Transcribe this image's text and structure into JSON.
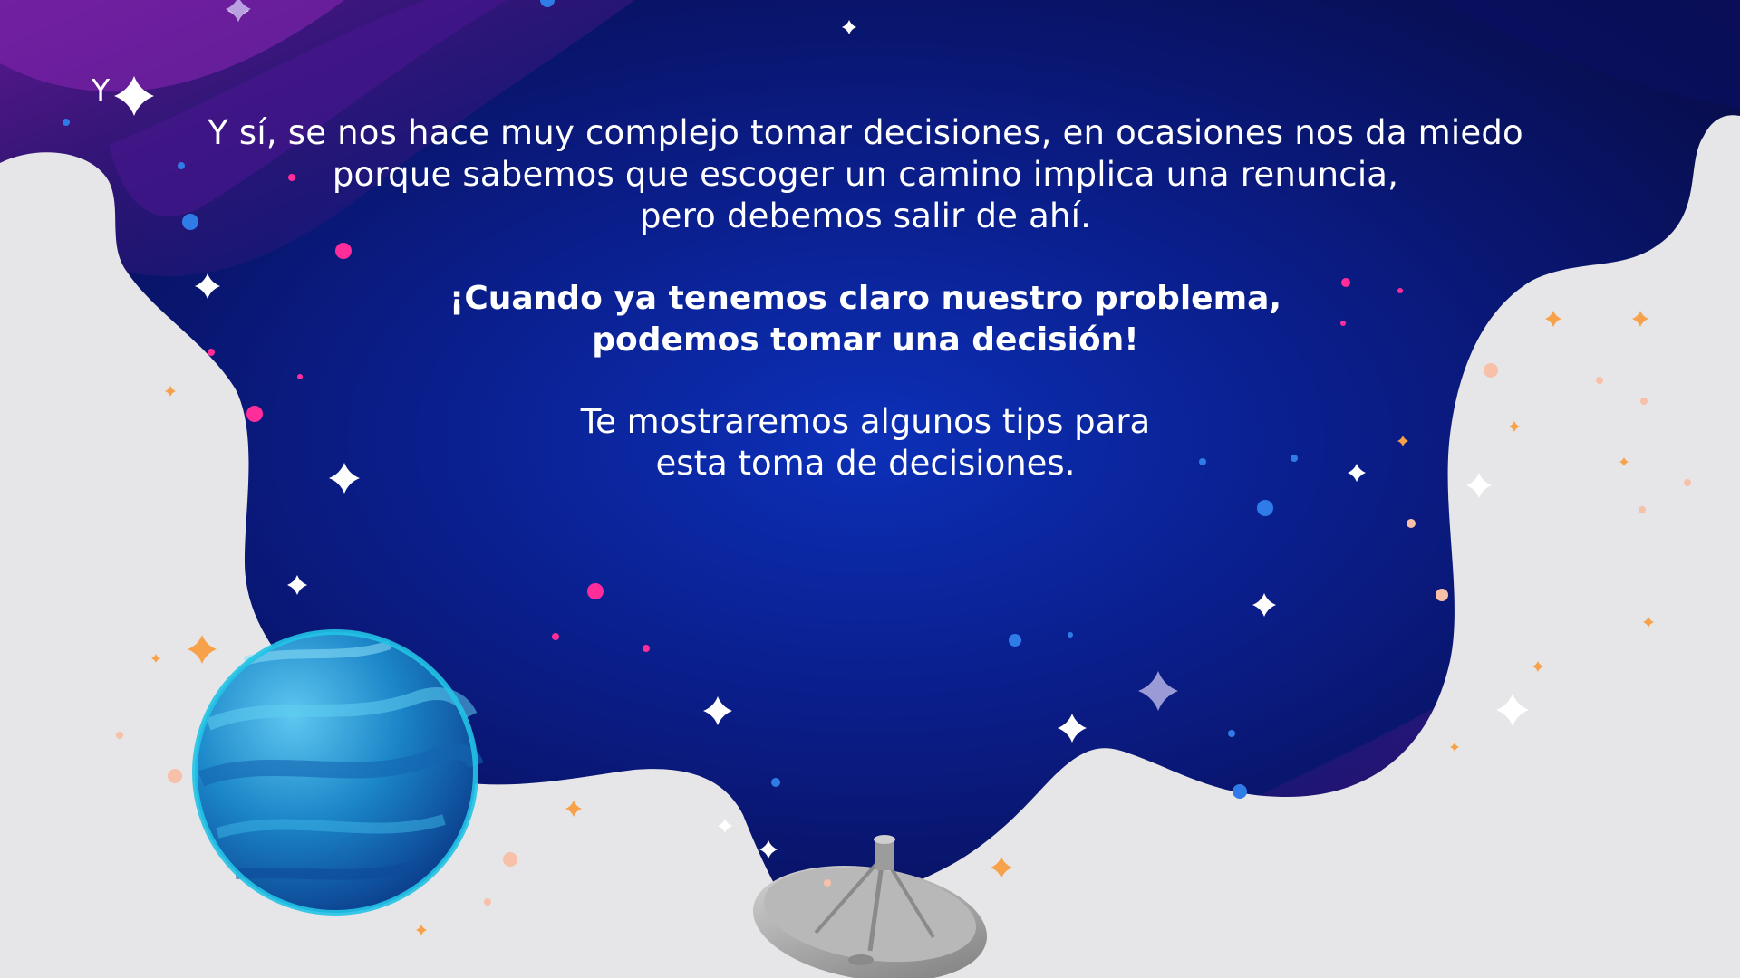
{
  "slide": {
    "corner_letter": "Y",
    "intro": {
      "line1": "Y sí, se nos hace muy complejo tomar decisiones, en ocasiones nos da miedo",
      "line2": "porque sabemos que escoger un camino implica una renuncia,",
      "line3": "pero debemos salir de ahí."
    },
    "highlight": {
      "line1": "¡Cuando ya tenemos claro nuestro problema,",
      "line2": "podemos tomar una decisión!"
    },
    "outro": {
      "line1": "Te mostraremos algunos tips para",
      "line2": "esta toma de decisiones."
    }
  },
  "colors": {
    "space_deep": "#0a0f52",
    "space_blue": "#0b2aa8",
    "space_purple": "#5a1a8c",
    "cloud": "#e6e6e8",
    "planet": "#1f86c4",
    "star_white": "#ffffff",
    "star_orange": "#f7a24a",
    "dot_pink": "#ff2d9a",
    "dot_blue": "#2f7be8"
  },
  "decorations": {
    "planet_icon": "blue-planet-icon",
    "antenna_icon": "satellite-dish-icon",
    "star_icon": "sparkle-star-icon"
  }
}
